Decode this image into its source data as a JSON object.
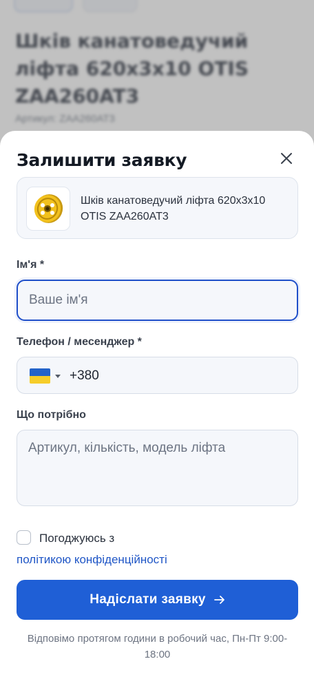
{
  "background": {
    "title": "Шків канатоведучий ліфта 620х3х10 OTIS ZAA260AT3",
    "sku_label": "Артикул: ZAA260AT3"
  },
  "sheet": {
    "title": "Залишити заявку",
    "product_name": "Шків канатоведучий ліфта 620х3х10 OTIS ZAA260AT3",
    "name_field": {
      "label": "Ім'я *",
      "placeholder": "Ваше ім'я",
      "value": ""
    },
    "phone_field": {
      "label": "Телефон / месенджер *",
      "value": "+380",
      "country": "Ukraine"
    },
    "need_field": {
      "label": "Що потрібно",
      "placeholder": "Артикул, кількість, модель ліфта"
    },
    "consent": {
      "text": "Погоджуюсь з",
      "link": "політикою конфіденційності",
      "checked": false
    },
    "submit_label": "Надіслати заявку",
    "footnote": "Відповімо протягом години в робочий час, Пн-Пт 9:00-18:00"
  },
  "colors": {
    "accent": "#1f5fd6",
    "link": "#1f56c6",
    "focus_border": "#1f4fc9",
    "field_bg": "#f5f7fb",
    "product_yellow": "#f2c11d"
  },
  "icons": {
    "close": "close-icon",
    "arrow": "arrow-right-icon",
    "caret": "chevron-down-icon",
    "flag": "ukraine-flag-icon"
  }
}
